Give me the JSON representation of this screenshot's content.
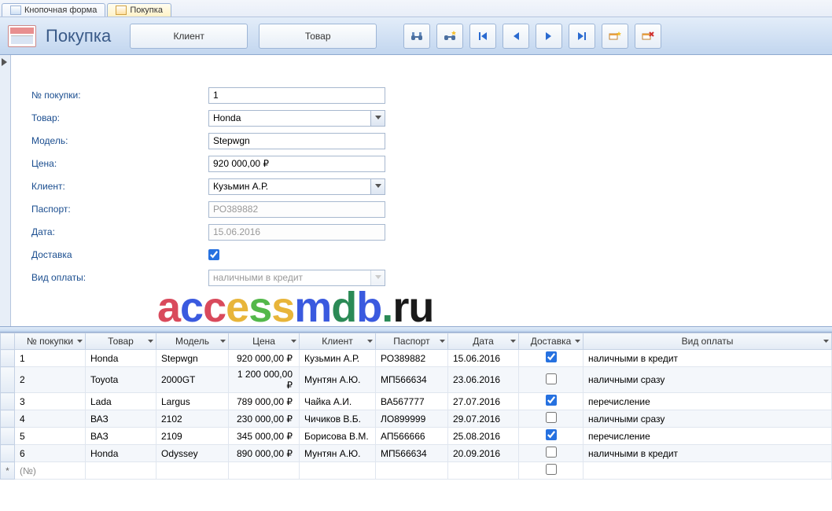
{
  "tabs": [
    {
      "label": "Кнопочная форма",
      "icon": "form"
    },
    {
      "label": "Покупка",
      "icon": "form2"
    }
  ],
  "header": {
    "title": "Покупка",
    "btn1": "Клиент",
    "btn2": "Товар"
  },
  "nav_icons": [
    "find",
    "find-replace",
    "first",
    "prev",
    "next",
    "last",
    "new",
    "delete"
  ],
  "form": {
    "labels": {
      "no": "№ покупки:",
      "product": "Товар:",
      "model": "Модель:",
      "price": "Цена:",
      "client": "Клиент:",
      "passport": "Паспорт:",
      "date": "Дата:",
      "delivery": "Доставка",
      "paytype": "Вид оплаты:"
    },
    "values": {
      "no": "1",
      "product": "Honda",
      "model": "Stepwgn",
      "price": "920 000,00 ₽",
      "client": "Кузьмин А.Р.",
      "passport": "РО389882",
      "date": "15.06.2016",
      "delivery": true,
      "paytype": "наличными в кредит"
    }
  },
  "watermark": "accessmdb.ru",
  "grid": {
    "columns": [
      "№ покупки",
      "Товар",
      "Модель",
      "Цена",
      "Клиент",
      "Паспорт",
      "Дата",
      "Доставка",
      "Вид оплаты"
    ],
    "new_row_placeholder": "(№)",
    "rows": [
      {
        "no": "1",
        "product": "Honda",
        "model": "Stepwgn",
        "price": "920 000,00 ₽",
        "client": "Кузьмин А.Р.",
        "passport": "РО389882",
        "date": "15.06.2016",
        "delivery": true,
        "paytype": "наличными в кредит"
      },
      {
        "no": "2",
        "product": "Toyota",
        "model": "2000GT",
        "price": "1 200 000,00 ₽",
        "client": "Мунтян А.Ю.",
        "passport": "МП566634",
        "date": "23.06.2016",
        "delivery": false,
        "paytype": "наличными сразу"
      },
      {
        "no": "3",
        "product": "Lada",
        "model": "Largus",
        "price": "789 000,00 ₽",
        "client": "Чайка А.И.",
        "passport": "ВА567777",
        "date": "27.07.2016",
        "delivery": true,
        "paytype": "перечисление"
      },
      {
        "no": "4",
        "product": "ВАЗ",
        "model": "2102",
        "price": "230 000,00 ₽",
        "client": "Чичиков В.Б.",
        "passport": "ЛО899999",
        "date": "29.07.2016",
        "delivery": false,
        "paytype": "наличными сразу"
      },
      {
        "no": "5",
        "product": "ВАЗ",
        "model": "2109",
        "price": "345 000,00 ₽",
        "client": "Борисова В.М.",
        "passport": "АП566666",
        "date": "25.08.2016",
        "delivery": true,
        "paytype": "перечисление"
      },
      {
        "no": "6",
        "product": "Honda",
        "model": "Odyssey",
        "price": "890 000,00 ₽",
        "client": "Мунтян А.Ю.",
        "passport": "МП566634",
        "date": "20.09.2016",
        "delivery": false,
        "paytype": "наличными в кредит"
      }
    ]
  }
}
